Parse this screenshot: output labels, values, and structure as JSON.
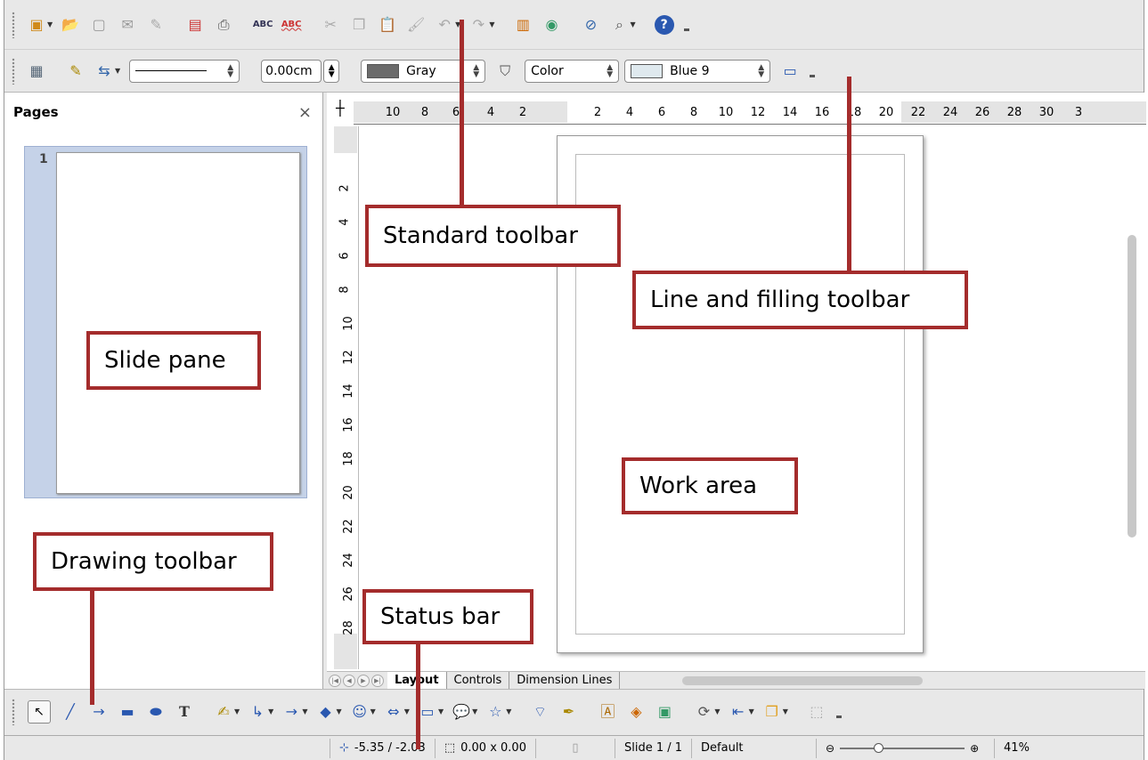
{
  "standard_toolbar": {
    "icons": [
      "new-icon",
      "open-icon",
      "save-icon",
      "email-icon",
      "edit-file-icon",
      "export-pdf-icon",
      "print-icon",
      "spellcheck-icon",
      "autospell-icon",
      "cut-icon",
      "copy-icon",
      "paste-icon",
      "clone-formatting-icon",
      "undo-icon",
      "redo-icon",
      "chart-icon",
      "gallery-icon",
      "navigator-icon",
      "zoom-icon",
      "help-icon"
    ]
  },
  "line_toolbar": {
    "line_width": "0.00cm",
    "line_color": "Gray",
    "line_color_hex": "#6b6b6b",
    "area_style": "Color",
    "area_color": "Blue 9",
    "area_color_hex": "#dfe9ee"
  },
  "pages_pane": {
    "title": "Pages",
    "close_symbol": "×",
    "slide_number": "1"
  },
  "ruler": {
    "horizontal_ticks": [
      "10",
      "8",
      "6",
      "4",
      "2",
      "2",
      "4",
      "6",
      "8",
      "10",
      "12",
      "14",
      "16",
      "18",
      "20",
      "22",
      "24",
      "26",
      "28",
      "30",
      "3"
    ],
    "vertical_ticks": [
      "2",
      "4",
      "6",
      "8",
      "10",
      "12",
      "14",
      "16",
      "18",
      "20",
      "22",
      "24",
      "26",
      "28"
    ]
  },
  "tabs": [
    "Layout",
    "Controls",
    "Dimension Lines"
  ],
  "status_bar": {
    "position": "-5.35 / -2.03",
    "size": "0.00 x 0.00",
    "slide": "Slide 1 / 1",
    "master": "Default",
    "zoom": "41%"
  },
  "annotations": {
    "standard_toolbar": "Standard toolbar",
    "line_filling_toolbar": "Line and filling toolbar",
    "slide_pane": "Slide pane",
    "work_area": "Work area",
    "drawing_toolbar": "Drawing toolbar",
    "status_bar": "Status bar"
  },
  "colors": {
    "annotation_border": "#a42c2c",
    "selected_slide_bg": "#c5d2e8"
  }
}
